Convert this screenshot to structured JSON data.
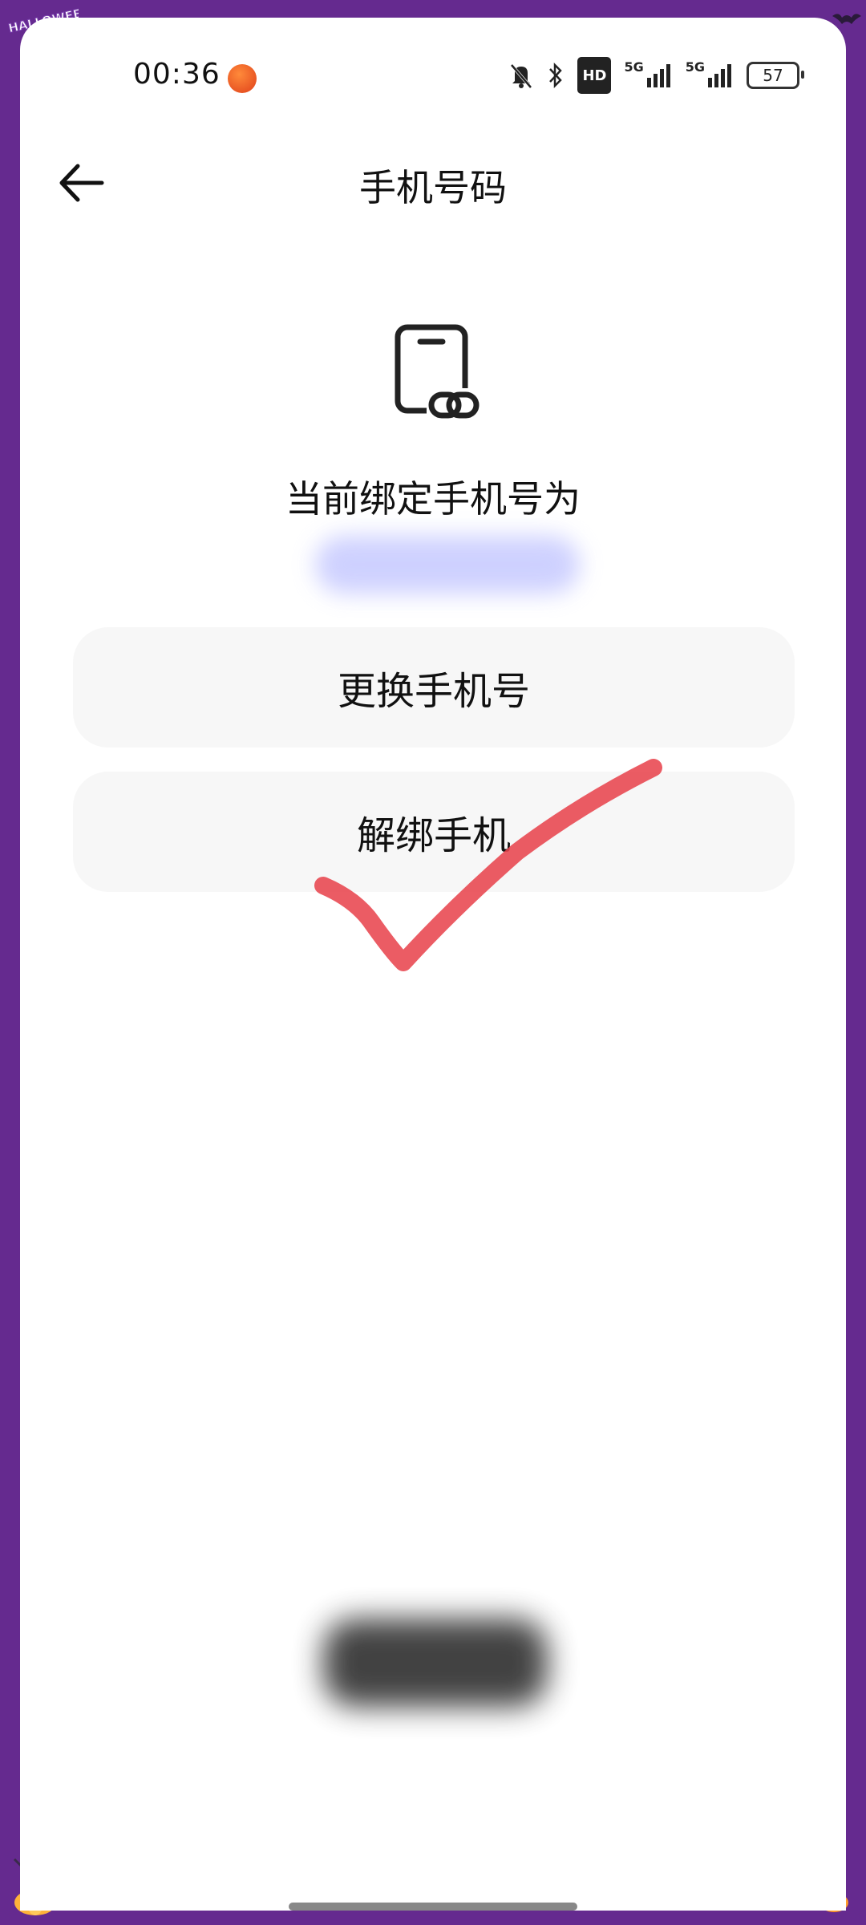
{
  "status_bar": {
    "time": "00:36",
    "hd_label": "HD",
    "signal1_label": "5G",
    "signal2_label": "5G",
    "battery": "57"
  },
  "header": {
    "title": "手机号码"
  },
  "main": {
    "bound_label": "当前绑定手机号为",
    "change_button": "更换手机号",
    "unbind_button": "解绑手机"
  },
  "decor": {
    "halloween_badge": "HALLOWEEN PARTY"
  },
  "colors": {
    "frame": "#652a8f",
    "card": "#f7f7f7",
    "checkmark": "#e8454f"
  }
}
